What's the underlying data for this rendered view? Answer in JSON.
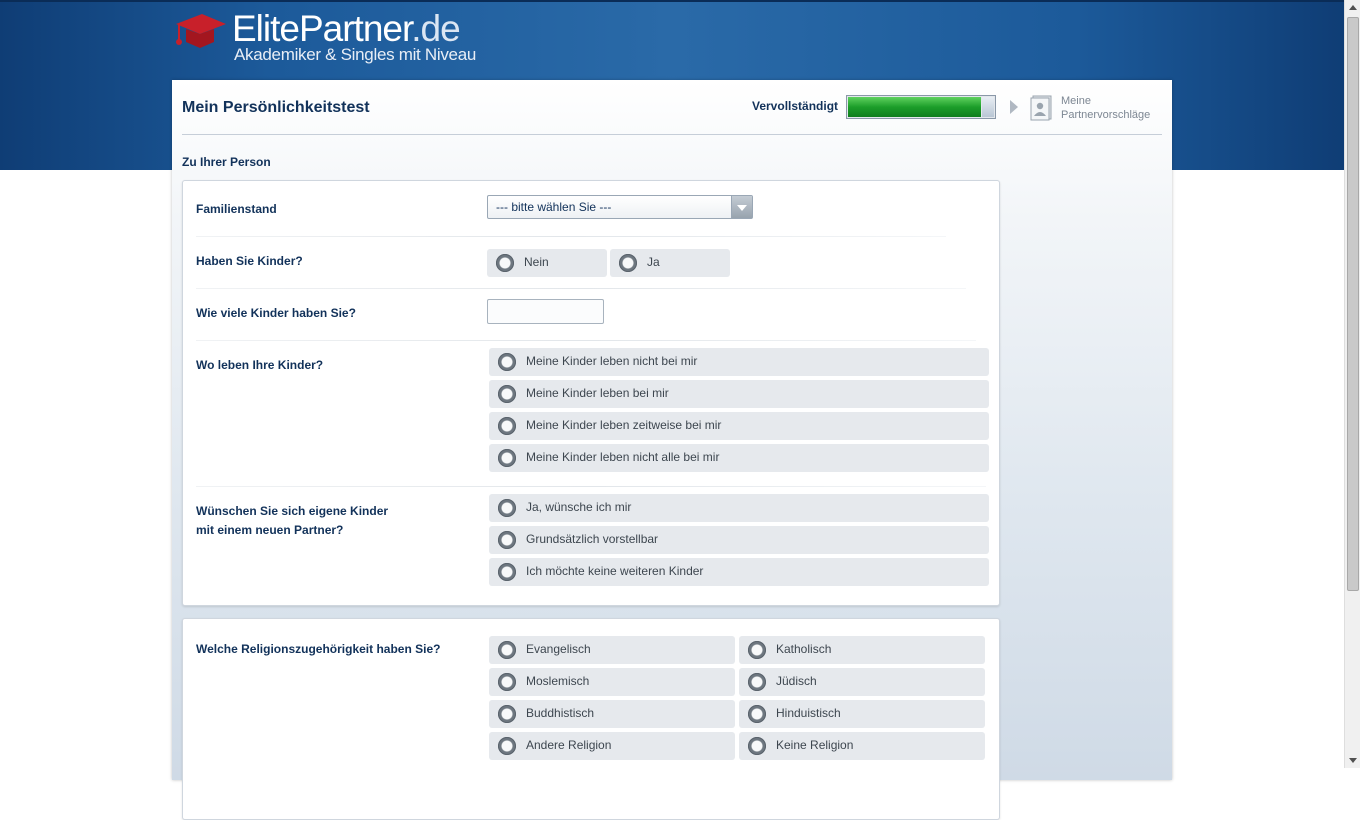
{
  "brand": {
    "name": "ElitePartner",
    "tld": ".de",
    "tagline": "Akademiker & Singles mit Niveau",
    "accent": "#c8202a"
  },
  "header": {
    "title": "Mein Persönlichkeitstest",
    "progress_label": "Vervollständigt",
    "progress_value": 0.91,
    "next_step_line1": "Meine",
    "next_step_line2": "Partnervorschläge"
  },
  "section": {
    "heading": "Zu Ihrer Person"
  },
  "questions": {
    "familienstand": {
      "label": "Familienstand",
      "selected": "--- bitte wählen Sie ---"
    },
    "kinder": {
      "label": "Haben Sie Kinder?",
      "options": [
        "Nein",
        "Ja"
      ]
    },
    "anzahl": {
      "label": "Wie viele Kinder haben Sie?",
      "value": ""
    },
    "wo": {
      "label": "Wo leben Ihre Kinder?",
      "options": [
        "Meine Kinder leben nicht bei mir",
        "Meine Kinder leben bei mir",
        "Meine Kinder leben zeitweise bei mir",
        "Meine Kinder leben nicht alle bei mir"
      ]
    },
    "wunsch": {
      "label_line1": "Wünschen Sie sich eigene Kinder",
      "label_line2": "mit einem neuen Partner?",
      "options": [
        "Ja, wünsche ich mir",
        "Grundsätzlich vorstellbar",
        "Ich möchte keine weiteren Kinder"
      ]
    },
    "religion": {
      "label": "Welche Religionszugehörigkeit haben Sie?",
      "options": [
        "Evangelisch",
        "Katholisch",
        "Moslemisch",
        "Jüdisch",
        "Buddhistisch",
        "Hinduistisch",
        "Andere Religion",
        "Keine Religion"
      ]
    }
  }
}
